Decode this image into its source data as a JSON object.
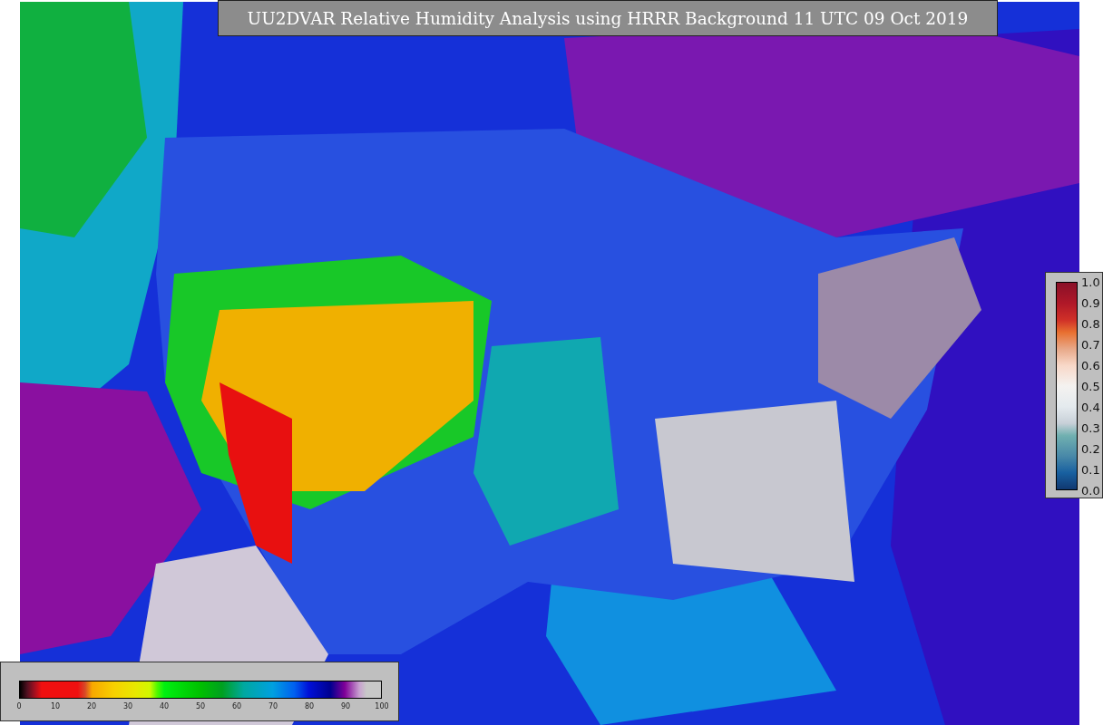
{
  "title": "UU2DVAR Relative Humidity Analysis using HRRR Background 11 UTC 09 Oct 2019",
  "humidity_legend": {
    "ticks": [
      "0",
      "10",
      "20",
      "30",
      "40",
      "50",
      "60",
      "70",
      "80",
      "90",
      "100"
    ]
  },
  "ratio_legend": {
    "ticks": [
      "1.0",
      "0.9",
      "0.8",
      "0.7",
      "0.6",
      "0.5",
      "0.4",
      "0.3",
      "0.2",
      "0.1",
      "0.0"
    ]
  }
}
